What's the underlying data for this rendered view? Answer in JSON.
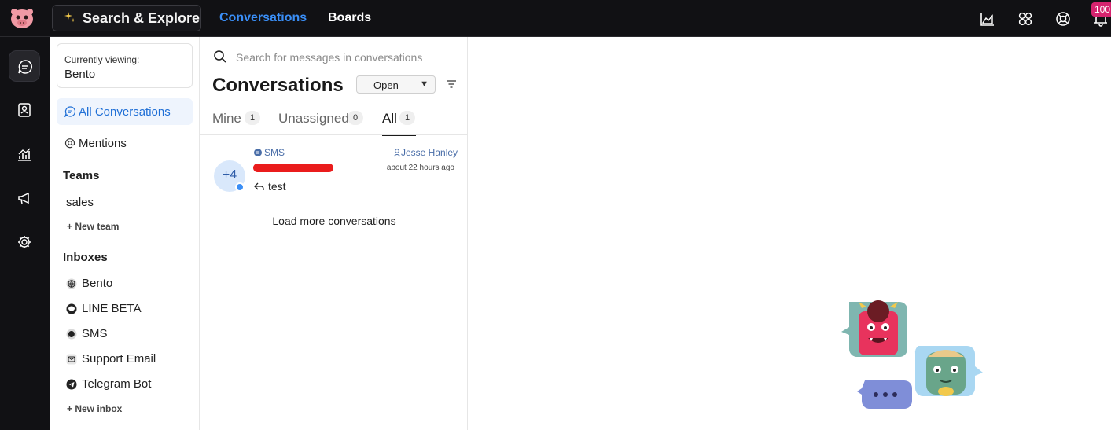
{
  "topbar": {
    "search_label": "Search & Explore",
    "nav": [
      "Conversations",
      "Boards"
    ],
    "active_nav": "Conversations",
    "notification_count": "100",
    "icons": [
      "reports-icon",
      "apps-icon",
      "help-icon",
      "bell-icon"
    ]
  },
  "rail": {
    "icons": [
      "conversations-icon",
      "contacts-icon",
      "reports-icon",
      "campaigns-icon",
      "settings-icon"
    ],
    "active": "conversations-icon"
  },
  "sidebar": {
    "viewing_label": "Currently viewing:",
    "viewing_value": "Bento",
    "items": [
      {
        "label": "All Conversations",
        "icon": "chat-icon",
        "active": true
      },
      {
        "label": "Mentions",
        "icon": "at-icon",
        "active": false
      }
    ],
    "teams": {
      "heading": "Teams",
      "items": [
        "sales"
      ],
      "new_label": "New team"
    },
    "inboxes": {
      "heading": "Inboxes",
      "items": [
        {
          "label": "Bento",
          "icon": "globe-icon"
        },
        {
          "label": "LINE BETA",
          "icon": "line-icon"
        },
        {
          "label": "SMS",
          "icon": "sms-icon"
        },
        {
          "label": "Support Email",
          "icon": "email-icon"
        },
        {
          "label": "Telegram Bot",
          "icon": "telegram-icon"
        }
      ],
      "new_label": "New inbox"
    }
  },
  "conversations": {
    "search_placeholder": "Search for messages in conversations",
    "title": "Conversations",
    "status": "Open",
    "tabs": [
      {
        "label": "Mine",
        "count": "1"
      },
      {
        "label": "Unassigned",
        "count": "0"
      },
      {
        "label": "All",
        "count": "1"
      }
    ],
    "active_tab": "All",
    "list": [
      {
        "avatar": "+4",
        "channel": "SMS",
        "assignee": "Jesse Hanley",
        "time": "about 22 hours ago",
        "last_message": "test"
      }
    ],
    "load_more": "Load more conversations"
  },
  "colors": {
    "topbar": "#111114",
    "accent": "#3a8ef6",
    "active_nav_bg": "#eef4fd",
    "badge": "#d6246f"
  }
}
